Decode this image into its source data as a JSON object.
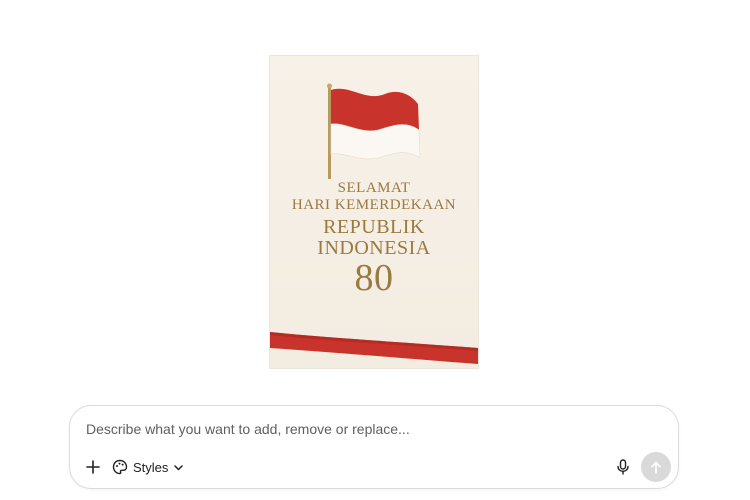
{
  "poster": {
    "line1": "SELAMAT",
    "line2": "HARI KEMERDEKAAN",
    "line3": "REPUBLIK",
    "line4": "INDONESIA",
    "line5": "80",
    "colors": {
      "red": "#c8342b",
      "gold": "#9a7a3f",
      "background": "#f5efe6"
    }
  },
  "composer": {
    "placeholder": "Describe what you want to add, remove or replace...",
    "styles_label": "Styles",
    "icons": [
      "plus-icon",
      "palette-icon",
      "chevron-down-icon",
      "microphone-icon",
      "arrow-up-icon"
    ]
  }
}
